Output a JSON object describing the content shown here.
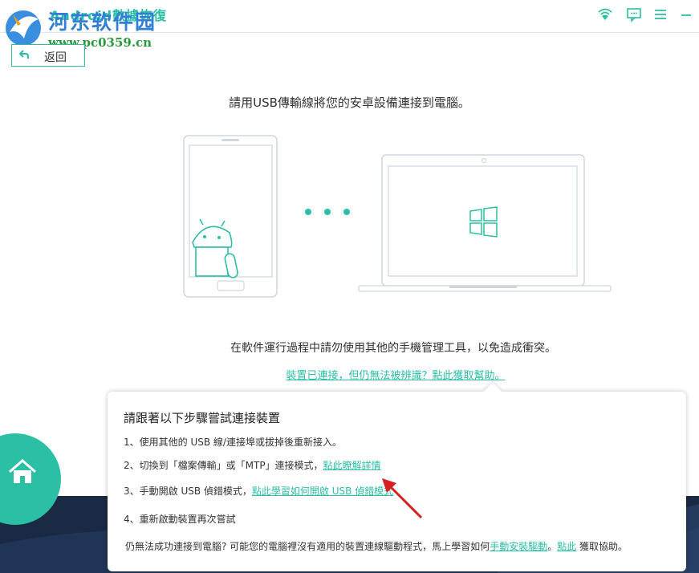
{
  "window": {
    "title": "Android數據恢復",
    "watermark": {
      "name": "河东软件园",
      "url": "www.pc0359.cn"
    }
  },
  "toolbar": {
    "icons": [
      "wifi-icon",
      "feedback-icon",
      "menu-icon",
      "minimize-icon"
    ]
  },
  "back_button": {
    "label": "返回"
  },
  "main": {
    "instruction": "請用USB傳輸線將您的安卓設備連接到電腦。",
    "warning": "在軟件運行過程中請勿使用其他的手機管理工具，以免造成衝突。",
    "help_link": "裝置已連接，但仍無法被辨識？點此獲取幫助。"
  },
  "popup": {
    "title": "請跟著以下步驟嘗試連接裝置",
    "steps": [
      {
        "text": "1、使用其他的 USB 線/連接埠或拔掉後重新接入。",
        "link": ""
      },
      {
        "text": "2、切換到「檔案傳輸」或「MTP」連接模式，",
        "link": "點此瞭解詳情"
      },
      {
        "text": "3、手動開啟 USB 偵錯模式，",
        "link": "點此學習如何開啟 USB 偵錯模式"
      },
      {
        "text": "4、重新啟動裝置再次嘗試",
        "link": ""
      }
    ],
    "footer": {
      "text1": "仍無法成功連接到電腦? 可能您的電腦裡沒有適用的裝置連線驅動程式，馬上學習如何",
      "link1": "手動安裝驅動",
      "sep": "。",
      "link2": "點此",
      "text2": " 獲取協助。"
    }
  },
  "colors": {
    "accent": "#2bbfa5",
    "bottom_band": "#1a2a44",
    "annotation_arrow": "#d42020"
  }
}
